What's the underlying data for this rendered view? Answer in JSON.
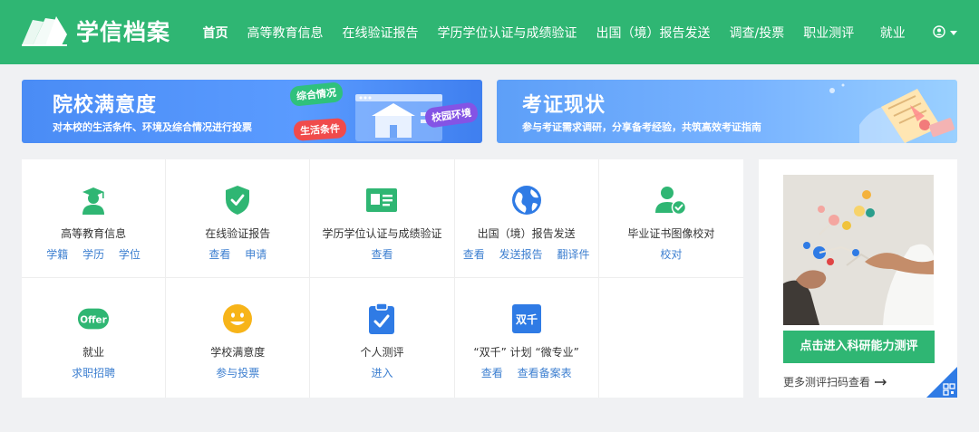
{
  "brand": {
    "name": "学信档案"
  },
  "nav": {
    "items": [
      {
        "label": "首页",
        "active": true
      },
      {
        "label": "高等教育信息"
      },
      {
        "label": "在线验证报告"
      },
      {
        "label": "学历学位认证与成绩验证"
      },
      {
        "label": "出国（境）报告发送"
      },
      {
        "label": "调查/投票"
      },
      {
        "label": "职业测评"
      },
      {
        "label": "就业"
      }
    ]
  },
  "banners": [
    {
      "title": "院校满意度",
      "subtitle": "对本校的生活条件、环境及综合情况进行投票",
      "tags": [
        "综合情况",
        "生活条件",
        "校园环境"
      ]
    },
    {
      "title": "考证现状",
      "subtitle": "参与考证需求调研，分享备考经验，共筑高效考证指南"
    }
  ],
  "services": [
    {
      "title": "高等教育信息",
      "icon": "graduate-icon",
      "links": [
        "学籍",
        "学历",
        "学位"
      ]
    },
    {
      "title": "在线验证报告",
      "icon": "shield-check-icon",
      "links": [
        "查看",
        "申请"
      ]
    },
    {
      "title": "学历学位认证与成绩验证",
      "icon": "id-card-icon",
      "links": [
        "查看"
      ]
    },
    {
      "title": "出国（境）报告发送",
      "icon": "globe-icon",
      "links": [
        "查看",
        "发送报告",
        "翻译件"
      ]
    },
    {
      "title": "毕业证书图像校对",
      "icon": "user-check-icon",
      "links": [
        "校对"
      ]
    },
    {
      "title": "就业",
      "icon": "offer-icon",
      "icon_text": "Offer",
      "links": [
        "求职招聘"
      ]
    },
    {
      "title": "学校满意度",
      "icon": "smile-icon",
      "links": [
        "参与投票"
      ]
    },
    {
      "title": "个人测评",
      "icon": "clipboard-check-icon",
      "links": [
        "进入"
      ]
    },
    {
      "title": "“双千” 计划 “微专业”",
      "icon": "shuangqian-icon",
      "icon_text": "双千",
      "links": [
        "查看",
        "查看备案表"
      ]
    }
  ],
  "side": {
    "button_label": "点击进入科研能力测评",
    "more_label": "更多测评扫码查看"
  },
  "colors": {
    "brand_green": "#2fb673",
    "link_blue": "#3d7fd0"
  }
}
